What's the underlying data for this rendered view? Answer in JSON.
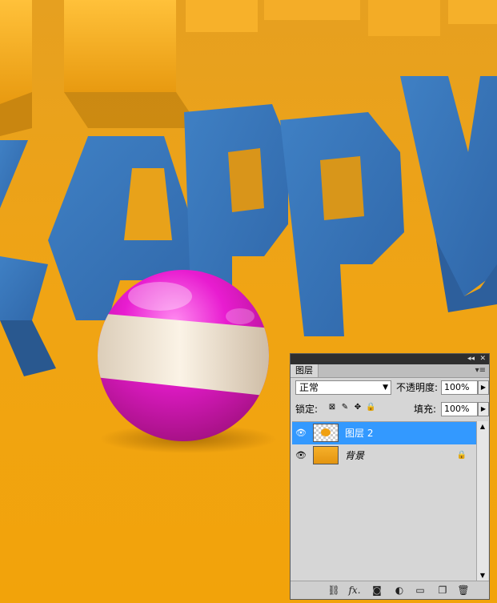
{
  "canvas": {
    "scene_word": "APPY"
  },
  "layers_panel": {
    "tab_label": "图层",
    "blend_mode": "正常",
    "opacity_label": "不透明度:",
    "opacity_value": "100%",
    "lock_label": "锁定:",
    "fill_label": "填充:",
    "fill_value": "100%",
    "layers": [
      {
        "name": "图层 2",
        "selected": true,
        "visible": true
      },
      {
        "name": "背景",
        "selected": false,
        "visible": true,
        "locked": true
      }
    ],
    "bottom_icons": [
      "link-icon",
      "fx-icon",
      "mask-icon",
      "adjustment-icon",
      "folder-icon",
      "new-layer-icon",
      "trash-icon"
    ],
    "fx_label": "fx."
  },
  "colors": {
    "background": "#f0a010",
    "letters": "#3a78b8",
    "selection": "#3399ff",
    "ball_pink": "#e020c8",
    "ball_stripe": "#f5ece0"
  }
}
